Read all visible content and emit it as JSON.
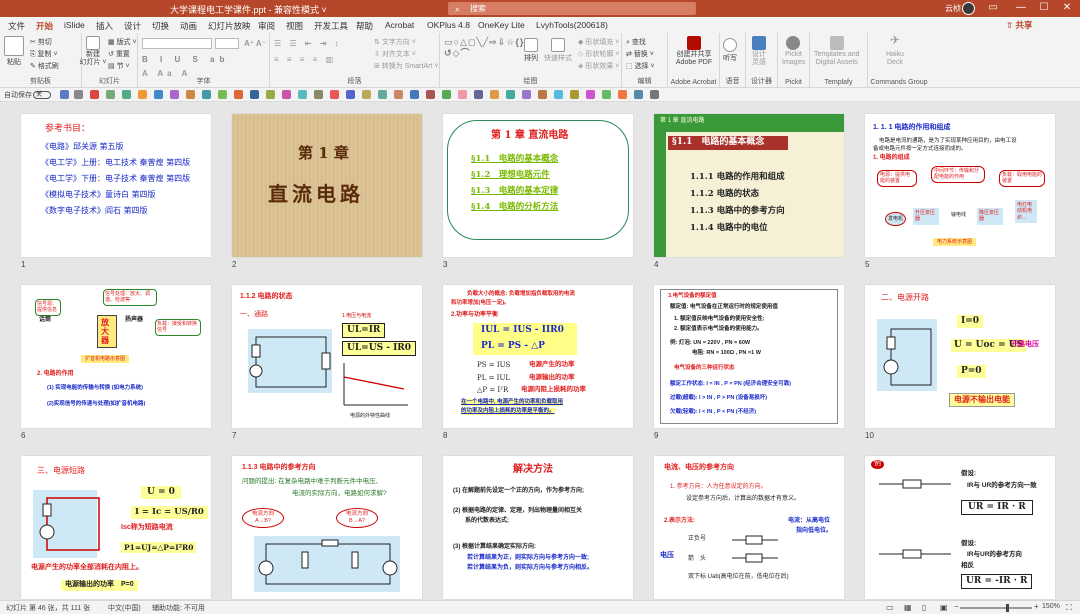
{
  "window": {
    "title": "大学课程电工学课件.ppt - 兼容性模式 ˅",
    "search_placeholder": "搜索",
    "user": "云桢",
    "minimize": "—",
    "maximize": "☐",
    "close": "✕"
  },
  "tabs": [
    "文件",
    "开始",
    "iSlide",
    "插入",
    "设计",
    "切换",
    "动画",
    "幻灯片放映",
    "审阅",
    "视图",
    "开发工具",
    "帮助",
    "Acrobat",
    "OKPlus 4.8",
    "OneKey Lite",
    "LvyhTools(200618)"
  ],
  "share": "共享",
  "ribbon": {
    "clipboard": {
      "label": "剪贴板",
      "paste": "粘贴",
      "cut": "剪切",
      "copy": "复制 ˅",
      "painter": "格式刷"
    },
    "slides": {
      "label": "幻灯片",
      "new": "新建\n幻灯片 ˅",
      "reuse": "重用\n幻灯片",
      "layout": "版式 ˅",
      "reset": "重置",
      "section": "节 ˅"
    },
    "font": {
      "label": "字体"
    },
    "paragraph": {
      "label": "段落",
      "dir": "文字方向 ˅",
      "align": "对齐文本 ˅",
      "smartart": "转换为 SmartArt ˅"
    },
    "drawing": {
      "label": "绘图",
      "arrange": "排列",
      "quick": "快速样式",
      "fill": "形状填充 ˅",
      "outline": "形状轮廓 ˅",
      "effect": "形状效果 ˅"
    },
    "editing": {
      "label": "编辑",
      "find": "查找",
      "replace": "替换 ˅",
      "select": "选择 ˅"
    },
    "acrobat": {
      "label": "Adobe Acrobat",
      "btn": "创建并共享\nAdobe PDF"
    },
    "voice": {
      "label": "语音",
      "btn": "听写"
    },
    "designer": {
      "label": "设计器",
      "btn": "设计\n灵感"
    },
    "pickit": {
      "label": "Pickit",
      "btn": "Pickit\nImages"
    },
    "templafy": {
      "label": "Templafy",
      "btn": "Templates and\nDigital Assets"
    },
    "haiku": {
      "label": "Commands Group",
      "btn": "Haiku\nDeck"
    }
  },
  "qat": {
    "autosave": "自动保存",
    "toggle": "关"
  },
  "slides": [
    {
      "n": "1",
      "lines": [
        "参考书目：",
        "《电路》邱关源 第五版",
        "《电工学》上册：电工技术 秦曾煌 第四版",
        "《电工学》下册：电子技术 秦曾煌 第四版",
        "《模拟电子技术》童诗白 第四版",
        "《数字电子技术》阎石 第四版"
      ]
    },
    {
      "n": "2",
      "chapter": "第 1 章",
      "title": "直流电路"
    },
    {
      "n": "3",
      "title": "第 1 章 直流电路",
      "items": [
        "§1.1　电路的基本概念",
        "§1.2　理想电路元件",
        "§1.3　电路的基本定律",
        "§1.4　电路的分析方法"
      ]
    },
    {
      "n": "4",
      "head": "第 1 章 直流电路",
      "title": "§1.1　电路的基本概念",
      "items": [
        "1.1.1 电路的作用和组成",
        "1.1.2 电路的状态",
        "1.1.3 电路中的参考方向",
        "1.1.4 电路中的电位"
      ]
    },
    {
      "n": "5",
      "title": "1. 1. 1 电路的作用和组成",
      "sub1": "电路是电流的通路，是为了实现某种应用目的，由电工设",
      "sub2": "备或电路元件按一定方式连接而成的。",
      "sub3": "1. 电路的组成",
      "b1": "电源：提供电能的装置",
      "b2": "中间环节：传输和分配电能的作用",
      "b3": "负载：取用电能的装置",
      "gen": "发电机",
      "t1": "升压变压器",
      "line": "输电线",
      "t2": "降压变压器",
      "load": "电灯电动机电炉...",
      "cap": "电力系统示意图"
    },
    {
      "n": "6",
      "b1": "信号源：提供信息",
      "b2": "信号处理：放大、调谐、检波等",
      "mic": "话筒",
      "amp": "放大器",
      "spk": "扬声器",
      "b3": "负载：接受和转换信号",
      "cap": "扩音机电路示意图",
      "h": "2. 电路的作用",
      "l1": "(1) 实现电能的传输与转换 (如电力系统)",
      "l2": "(2)实现信号的传递与处理(如扩音机电路)"
    },
    {
      "n": "7",
      "title": "1.1.2 电路的状态",
      "sub": "一、通路",
      "f0": "1.电压与电流",
      "f1": "UL=IR",
      "f2": "UL=US - IR0",
      "cap": "电源的外特性曲线"
    },
    {
      "n": "8",
      "l1": "负载大小的概念: 负载增加指负载取用的电流",
      "l2": "和功率增加(电压一定)。",
      "h": "2.功率与功率平衡",
      "f1": "IUL = IUS - IIR0",
      "f2": "PL = PS - △P",
      "r1": "PS = IUS",
      "r1b": "电源产生的功率",
      "r2": "PL = IUL",
      "r2b": "电源输出的功率",
      "r3": "△P = I²R",
      "r3b": "电源内阻上损耗的功率",
      "n1": "在一个电路中, 电源产生的功率和负载取用",
      "n2": "的功率及内阻上损耗的功率是平衡的。"
    },
    {
      "n": "9",
      "h": "3.电气设备的额定值",
      "l1": "额定值: 电气设备在正常运行时的规定使用值",
      "l2": "1. 额定值反映电气设备的使用安全性;",
      "l3": "2. 额定值表示电气设备的使用能力。",
      "l4": "例: 灯泡:  UN = 220V , PN = 60W",
      "l5": "电阻:  RN = 100Ω , PN =1 W",
      "h2": "电气设备的三种运行状态",
      "l6": "额定工作状态: I = IN , P = PN (经济合理安全可靠)",
      "l7": "过载(超载): I > IN , P > PN (设备易损坏)",
      "l8": "欠载(轻载): I < IN , P < PN (不经济)"
    },
    {
      "n": "10",
      "title": "二、电源开路",
      "f1": "I=0",
      "f2": "U = Uoc = US",
      "f2b": "开路电压",
      "f3": "P=0",
      "f4": "电源不输出电能"
    },
    {
      "n": "11",
      "title": "三、电源短路",
      "f1": "U = 0",
      "f2": "I = Ic = US/R0",
      "f3": "Isc称为短路电流",
      "f4": "P1=UJ=△P=I²R0",
      "n1": "电源产生的功率全部消耗在内阻上。",
      "n2": "电源输出的功率　P=0"
    },
    {
      "n": "12",
      "title": "1.1.3 电路中的参考方向",
      "l1": "问题的提出: 在复杂电路中难于判断元件中电压、",
      "l2": "电流的实际方向，电路如何求解?",
      "c1": "电流方向 A→B?",
      "c2": "电流方向 B→A?"
    },
    {
      "n": "13",
      "title": "解决方法",
      "l1": "(1) 在解题前先设定一个正的方向，作为参考方向;",
      "l2": "(2) 根据电路的定律、定理，列出物理量间相互关",
      "l2b": "系的代数表达式;",
      "l3": "(3) 根据计算结果确定实际方向:",
      "l4": "若计算结果为正，则实际方向与参考方向一致;",
      "l5": "若计算结果为负，则实际方向与参考方向相反。"
    },
    {
      "n": "14",
      "title": "电流、电压的参考方向",
      "l1": "1. 参考方向：人为任意设定的方向。",
      "l2": "设定参考方向后，计算出的数据才有意义。",
      "l3": "2.表示方法:",
      "l4": "电流：从高电位",
      "l4b": "指向低电位。",
      "ud": "电压",
      "m1": "正负号",
      "m2": "箭　头",
      "m3": "双下标 Uab(高电位在前，低电位在后)"
    },
    {
      "n": "15",
      "tag": "例",
      "l1": "假设:",
      "l2": "IR与 UR的参考方向一致",
      "f1": "UR = IR · R",
      "l3": "假设:",
      "l4": "IR与UR的参考方向",
      "l4b": "相反",
      "f2": "UR = -IR · R"
    }
  ],
  "status": {
    "left": "幻灯片 第 46 张，共 111 张",
    "lang": "中文(中国)",
    "access": "辅助功能: 不可用",
    "zoom": "150%"
  }
}
